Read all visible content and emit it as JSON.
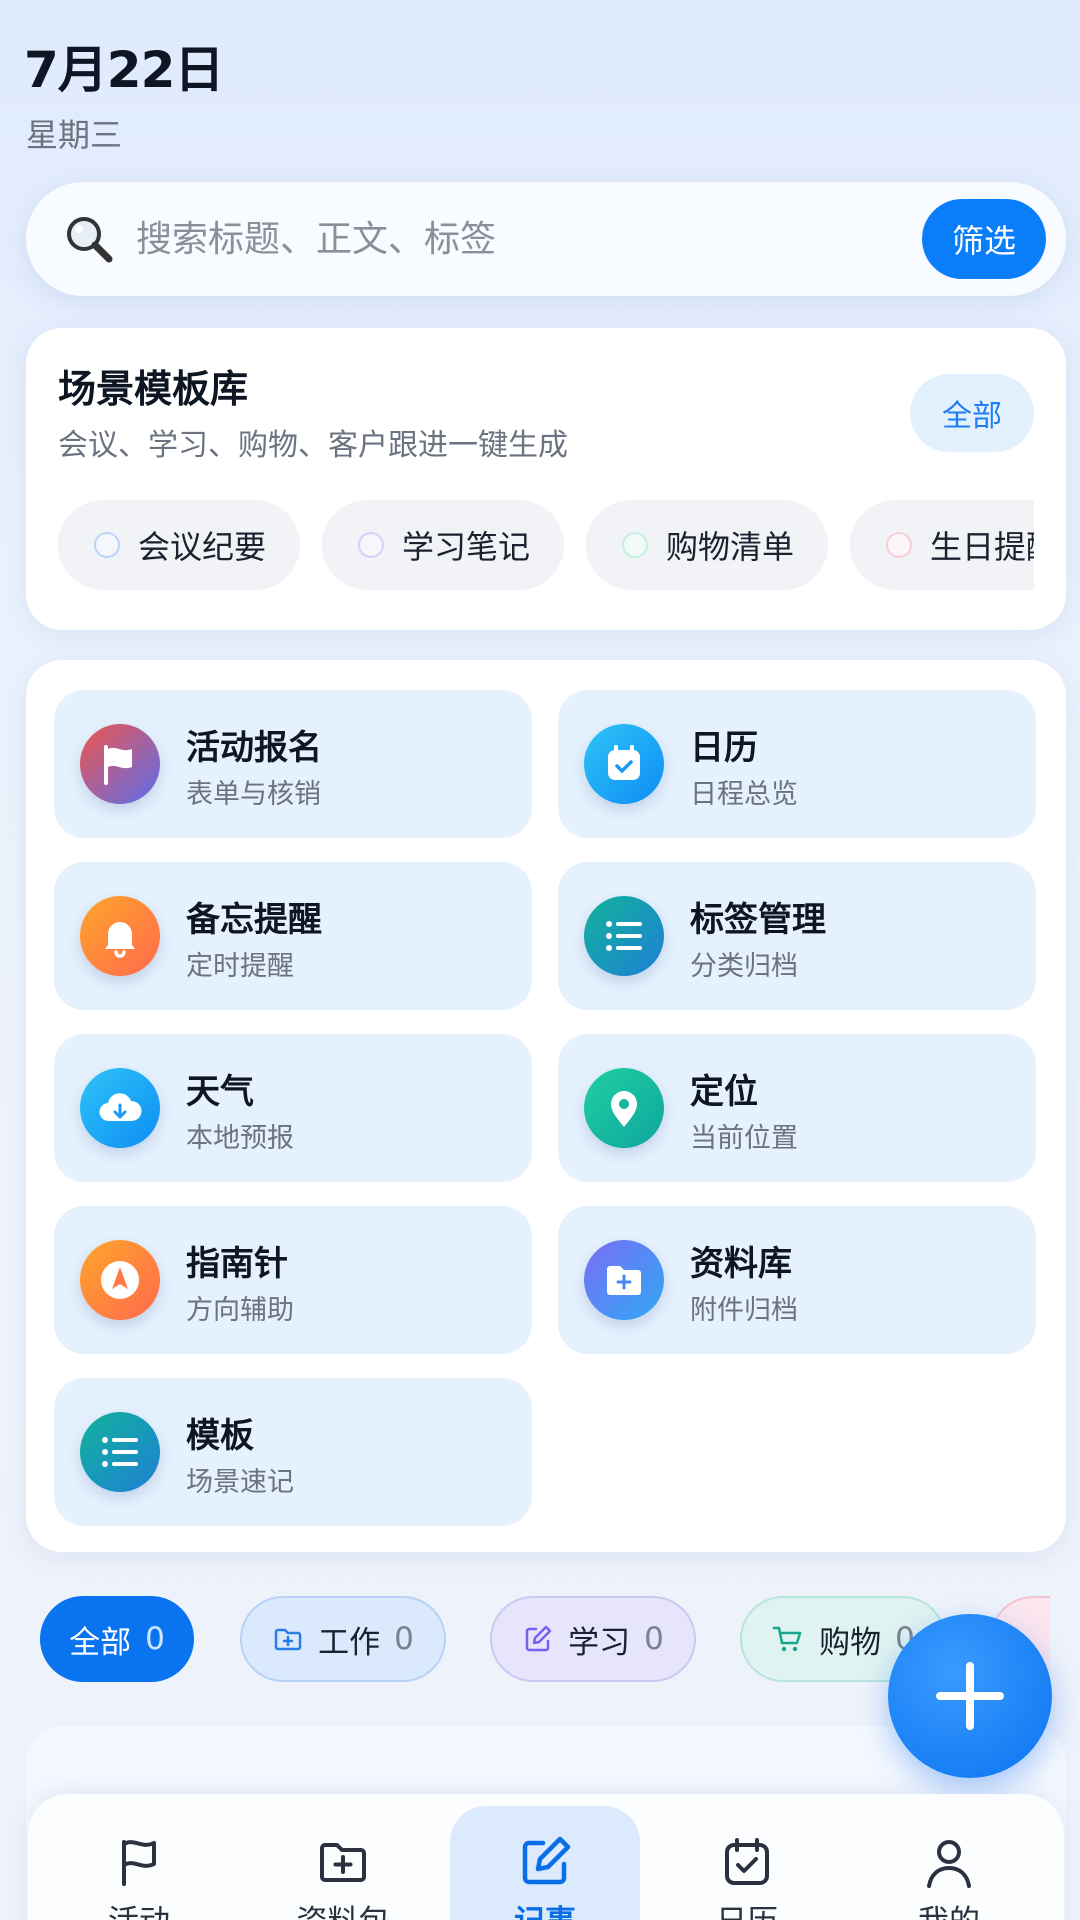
{
  "header": {
    "date": "7月22日",
    "weekday": "星期三"
  },
  "search": {
    "placeholder": "搜索标题、正文、标签",
    "filter_label": "筛选"
  },
  "templates": {
    "title": "场景模板库",
    "subtitle": "会议、学习、购物、客户跟进一键生成",
    "all_label": "全部",
    "chips": [
      {
        "label": "会议纪要",
        "color": "#7fb3f5"
      },
      {
        "label": "学习笔记",
        "color": "#b9a6f2"
      },
      {
        "label": "购物清单",
        "color": "#8ee0c8"
      },
      {
        "label": "生日提醒",
        "color": "#f5a3b8"
      }
    ]
  },
  "tools": [
    {
      "name": "活动报名",
      "desc": "表单与核销",
      "icon": "flag-icon"
    },
    {
      "name": "日历",
      "desc": "日程总览",
      "icon": "calendar-icon"
    },
    {
      "name": "备忘提醒",
      "desc": "定时提醒",
      "icon": "bell-icon"
    },
    {
      "name": "标签管理",
      "desc": "分类归档",
      "icon": "list-icon"
    },
    {
      "name": "天气",
      "desc": "本地预报",
      "icon": "cloud-download-icon"
    },
    {
      "name": "定位",
      "desc": "当前位置",
      "icon": "location-pin-icon"
    },
    {
      "name": "指南针",
      "desc": "方向辅助",
      "icon": "compass-icon"
    },
    {
      "name": "资料库",
      "desc": "附件归档",
      "icon": "folder-plus-icon"
    },
    {
      "name": "模板",
      "desc": "场景速记",
      "icon": "list-icon"
    }
  ],
  "categories": [
    {
      "label": "全部",
      "count": "0",
      "icon": ""
    },
    {
      "label": "工作",
      "count": "0",
      "icon": "folder-plus-icon"
    },
    {
      "label": "学习",
      "count": "0",
      "icon": "edit-icon"
    },
    {
      "label": "购物",
      "count": "0",
      "icon": "cart-icon"
    }
  ],
  "tabbar": [
    {
      "label": "活动",
      "icon": "flag-icon"
    },
    {
      "label": "资料包",
      "icon": "folder-plus-icon"
    },
    {
      "label": "记事",
      "icon": "edit-icon",
      "active": true
    },
    {
      "label": "日历",
      "icon": "calendar-check-icon"
    },
    {
      "label": "我的",
      "icon": "user-icon"
    }
  ],
  "colors": {
    "primary": "#0a7dfa",
    "tile_bg": "#e5f1fd"
  }
}
